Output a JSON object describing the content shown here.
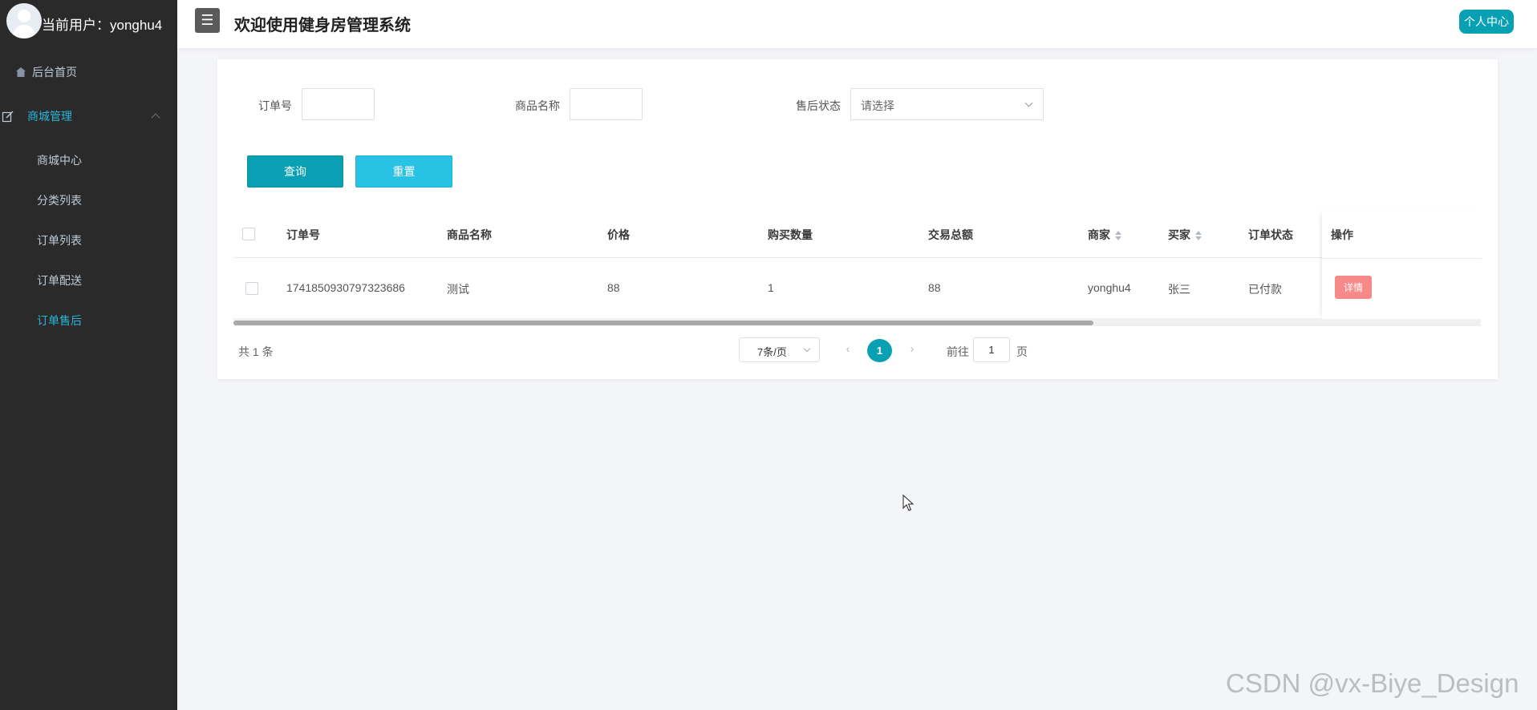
{
  "sidebar": {
    "user_label": "当前用户：yonghu4",
    "items": [
      {
        "label": "后台首页",
        "icon": "home-icon"
      },
      {
        "label": "商城管理",
        "icon": "edit-icon"
      }
    ],
    "sub_items": [
      "商城中心",
      "分类列表",
      "订单列表",
      "订单配送",
      "订单售后"
    ],
    "active_sub_item": "订单售后"
  },
  "header": {
    "menu_icon": "menu-icon",
    "title": "欢迎使用健身房管理系统",
    "profile_button": "个人中心"
  },
  "filters": {
    "order_no_label": "订单号",
    "order_no_value": "",
    "product_name_label": "商品名称",
    "product_name_value": "",
    "after_sale_status_label": "售后状态",
    "after_sale_status_value": "请选择"
  },
  "buttons": {
    "query": "查询",
    "reset": "重置"
  },
  "table": {
    "columns": [
      "订单号",
      "商品名称",
      "价格",
      "购买数量",
      "交易总额",
      "商家",
      "买家",
      "订单状态",
      "操作"
    ],
    "sortable_columns": [
      "商家",
      "买家"
    ],
    "rows": [
      {
        "order_no": "1741850930797323686",
        "product_name": "测试",
        "price": "88",
        "quantity": "1",
        "total": "88",
        "merchant": "yonghu4",
        "buyer": "张三",
        "status": "已付款",
        "action": "详情"
      }
    ]
  },
  "pagination": {
    "total_text": "共 1 条",
    "page_size": "7条/页",
    "current_page": "1",
    "goto_label": "前往",
    "goto_value": "1",
    "page_suffix": "页"
  },
  "watermark": "CSDN @vx-Biye_Design",
  "colors": {
    "sidebar_bg": "#2a2a2a",
    "accent": "#0aa0b3",
    "reset_button": "#28c2e4",
    "detail_button": "#f78989",
    "active_menu": "#29b6d9"
  }
}
